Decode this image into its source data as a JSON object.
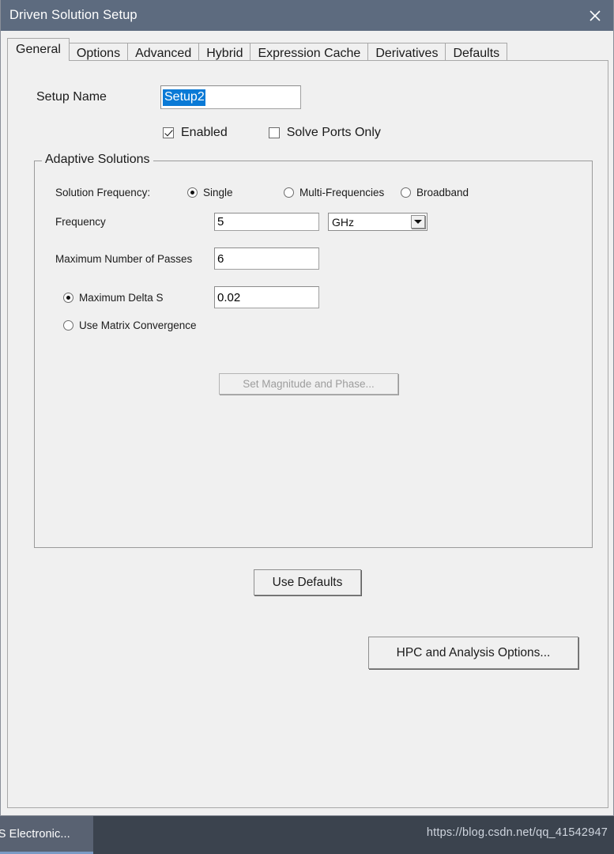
{
  "window": {
    "title": "Driven Solution Setup",
    "close_icon": "close-icon",
    "titlebar_color": "#5d6b7f",
    "body_color": "#f0f0f0"
  },
  "tabs": [
    {
      "label": "General",
      "selected": true
    },
    {
      "label": "Options",
      "selected": false
    },
    {
      "label": "Advanced",
      "selected": false
    },
    {
      "label": "Hybrid",
      "selected": false
    },
    {
      "label": "Expression Cache",
      "selected": false
    },
    {
      "label": "Derivatives",
      "selected": false
    },
    {
      "label": "Defaults",
      "selected": false
    }
  ],
  "general": {
    "setup_name": {
      "label": "Setup Name",
      "value": "Setup2",
      "selected": true,
      "selection_color": "#0a7ad6"
    },
    "checkboxes": [
      {
        "label": "Enabled",
        "checked": true
      },
      {
        "label": "Solve Ports Only",
        "checked": false
      }
    ],
    "adaptive_solutions": {
      "title": "Adaptive Solutions",
      "solution_frequency": {
        "label": "Solution Frequency:",
        "options": [
          {
            "label": "Single",
            "selected": true
          },
          {
            "label": "Multi-Frequencies",
            "selected": false
          },
          {
            "label": "Broadband",
            "selected": false
          }
        ]
      },
      "frequency": {
        "label": "Frequency",
        "value": "5",
        "unit": "GHz",
        "unit_arrow_icon": "chevron-down-icon"
      },
      "max_passes": {
        "label": "Maximum Number of Passes",
        "value": "6"
      },
      "convergence": {
        "max_delta_s": {
          "label": "Maximum Delta S",
          "selected": true,
          "value": "0.02"
        },
        "use_matrix_convergence": {
          "label": "Use Matrix Convergence",
          "selected": false,
          "button_label": "Set Magnitude and Phase...",
          "button_disabled": true
        }
      }
    },
    "use_defaults_button": "Use Defaults",
    "hpc_button": "HPC and Analysis Options..."
  },
  "taskbar": {
    "item_label": "YS Electronic...",
    "watermark": "https://blog.csdn.net/qq_41542947",
    "accent_color": "#7a9ac4"
  }
}
